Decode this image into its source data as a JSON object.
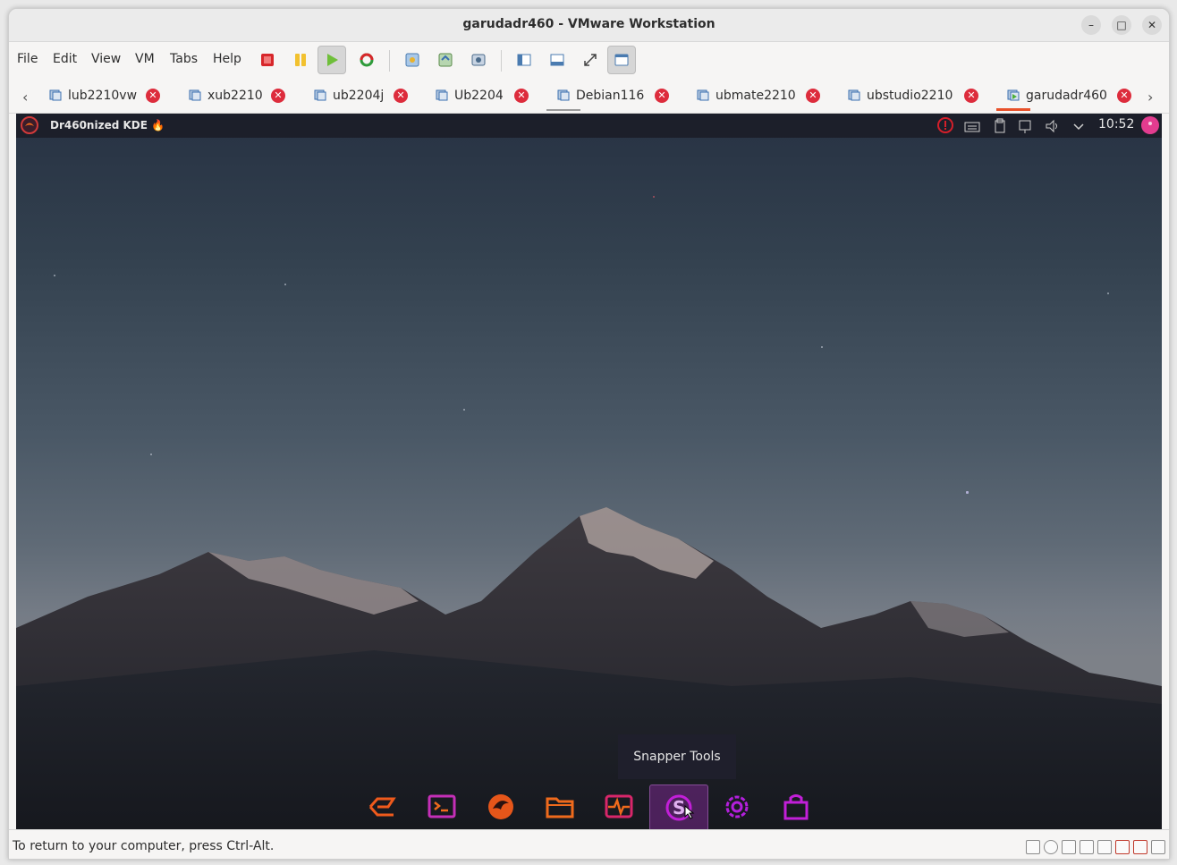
{
  "window": {
    "title": "garudadr460 - VMware Workstation"
  },
  "menu": [
    "File",
    "Edit",
    "View",
    "VM",
    "Tabs",
    "Help"
  ],
  "toolbar": {
    "icons": [
      "power-off-icon",
      "suspend-icon",
      "play-icon",
      "restart-icon",
      "snapshot-take-icon",
      "snapshot-revert-icon",
      "snapshot-manager-icon",
      "library-icon",
      "thumbnail-bar-icon",
      "fullscreen-icon",
      "unity-view-icon"
    ]
  },
  "tabs": [
    {
      "label": "lub2210vw"
    },
    {
      "label": "xub2210"
    },
    {
      "label": "ub2204j"
    },
    {
      "label": "Ub2204"
    },
    {
      "label": "Debian116"
    },
    {
      "label": "ubmate2210"
    },
    {
      "label": "ubstudio2210"
    },
    {
      "label": "garudadr460"
    }
  ],
  "guest": {
    "panel_title": "Dr460nized KDE 🔥",
    "clock": "10:52",
    "tooltip": "Snapper Tools",
    "dock": [
      "garuda-icon",
      "terminal-icon",
      "garuda-dragon-icon",
      "files-icon",
      "system-monitor-icon",
      "snapper-tools-icon",
      "settings-icon",
      "software-store-icon"
    ],
    "colors": {
      "panel": "#1c1f2a",
      "accent_orange": "#ef6a1c",
      "accent_magenta": "#c21fd8"
    }
  },
  "status": {
    "message": "To return to your computer, press Ctrl-Alt."
  }
}
